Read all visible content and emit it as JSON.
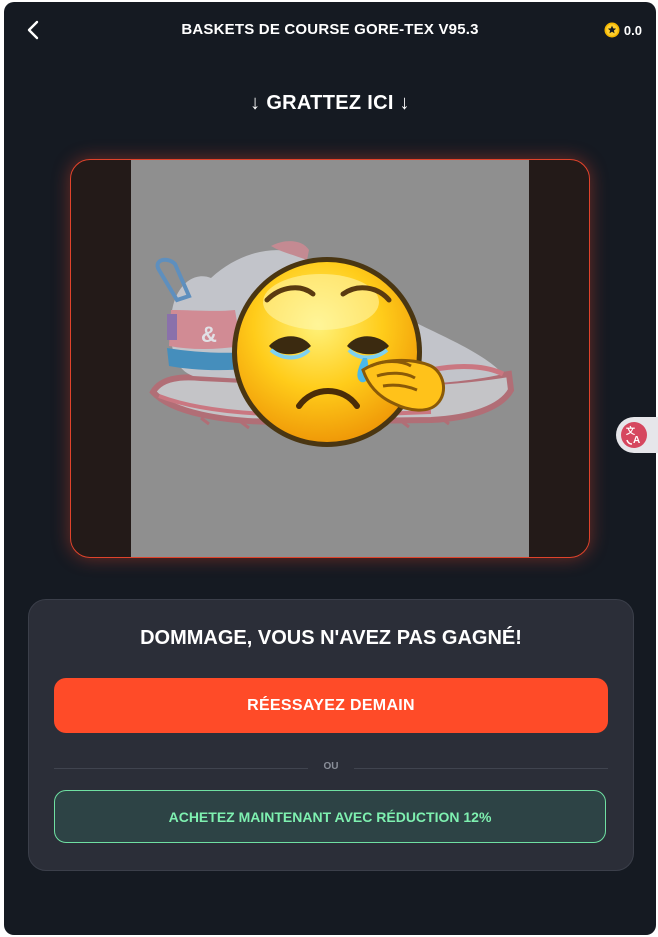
{
  "header": {
    "title": "BASKETS DE COURSE GORE-TEX V95.3",
    "coin_balance": "0.0",
    "back_icon": "chevron-left-icon",
    "coin_icon": "star-coin-icon"
  },
  "scratch": {
    "prompt": "↓ GRATTEZ ICI ↓",
    "image_subject": "running-shoe",
    "overlay_emoji": "crying-face-emoji"
  },
  "result": {
    "title": "DOMMAGE, VOUS N'AVEZ PAS GAGNÉ!",
    "retry_label": "RÉESSAYEZ DEMAIN",
    "or_label": "OU",
    "buy_label": "ACHETEZ MAINTENANT AVEC RÉDUCTION 12%"
  },
  "colors": {
    "background": "#151a22",
    "accent_red": "#ff4b28",
    "accent_green": "#6fe0a2",
    "panel": "#2b2e38"
  },
  "floating": {
    "translate_icon": "translate-icon"
  }
}
